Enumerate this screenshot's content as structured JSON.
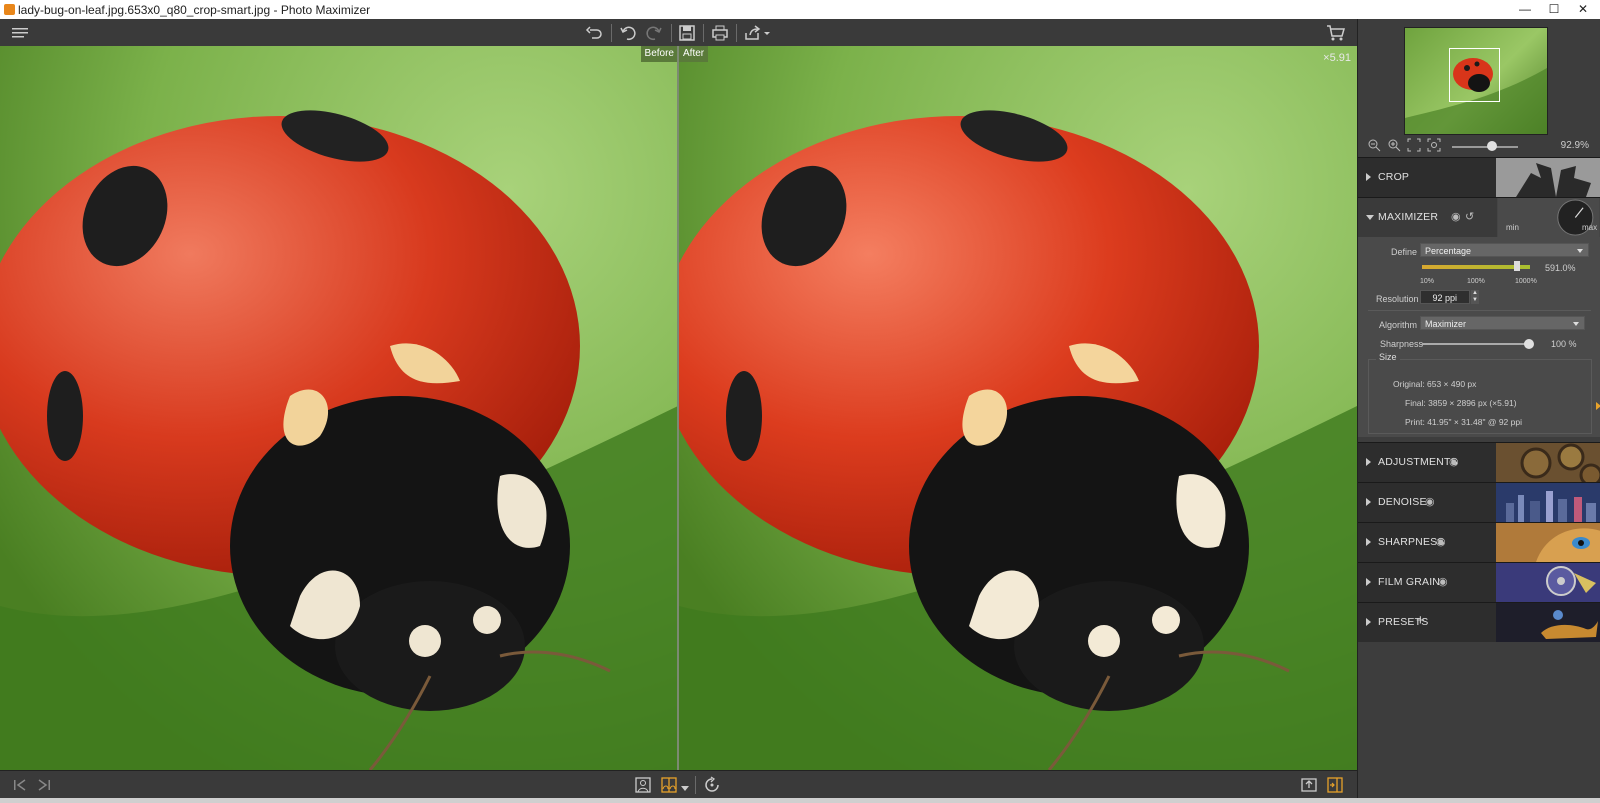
{
  "window": {
    "title": "lady-bug-on-leaf.jpg.653x0_q80_crop-smart.jpg - Photo Maximizer",
    "minimize": "—",
    "maximize": "☐",
    "close": "✕"
  },
  "toolbar": {
    "icons": [
      "menu-icon",
      "undo-all-icon",
      "undo-icon",
      "redo-icon",
      "save-icon",
      "print-icon",
      "share-icon",
      "cart-icon"
    ]
  },
  "viewer": {
    "before_label": "Before",
    "after_label": "After",
    "zoom_label": "×5.91"
  },
  "navigator": {
    "zoom_percent": "92.9%",
    "zoom_fraction": 0.6
  },
  "sections": {
    "crop": "CROP",
    "maximizer": "MAXIMIZER",
    "adjustments": "ADJUSTMENTS",
    "denoise": "DENOISE",
    "sharpness": "SHARPNESS",
    "film_grain": "FILM GRAIN",
    "presets": "PRESETS"
  },
  "maximizer": {
    "define_label": "Define",
    "define_value": "Percentage",
    "scale_value": "591.0%",
    "scale_ticks": [
      "10%",
      "100%",
      "1000%"
    ],
    "resolution_label": "Resolution",
    "resolution_value": "92 ppi",
    "algorithm_label": "Algorithm",
    "algorithm_value": "Maximizer",
    "sharpness_label": "Sharpness",
    "sharpness_value": "100 %",
    "knob_min": "min",
    "knob_max": "max",
    "size_title": "Size",
    "original": "Original: 653 × 490 px",
    "final": "Final: 3859 × 2896 px (×5.91)",
    "print": "Print: 41.95\" × 31.48\" @ 92 ppi"
  },
  "colors": {
    "accent": "#e8a22a",
    "panel_bg": "#3d3d3d"
  }
}
